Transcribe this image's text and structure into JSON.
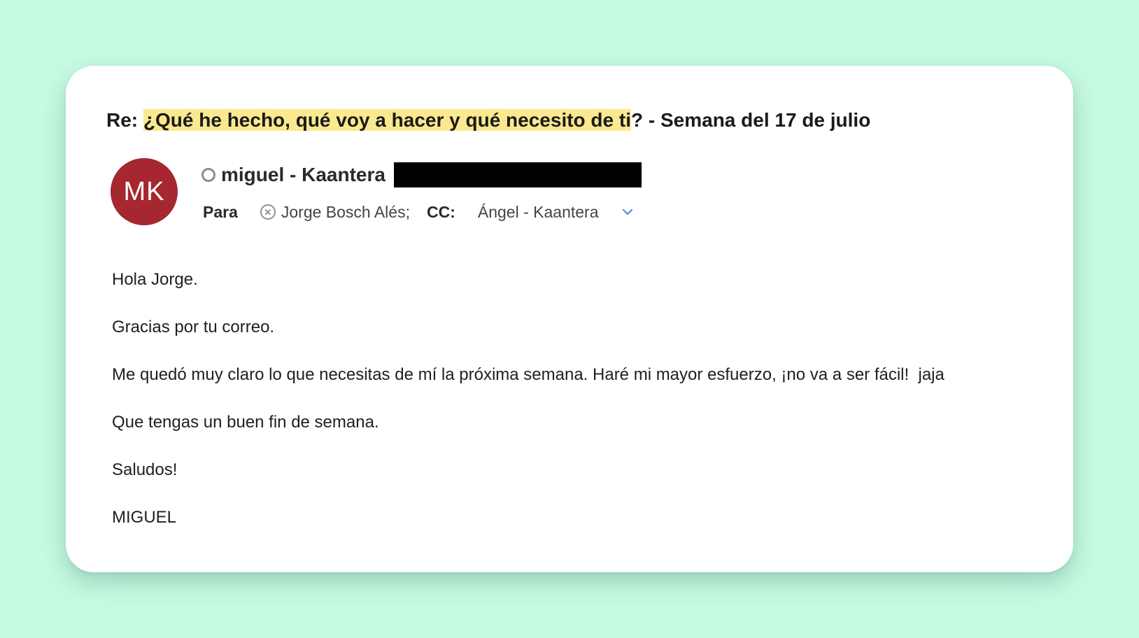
{
  "email": {
    "subject_prefix": "Re: ",
    "subject_highlight": "¿Qué he hecho, qué voy a hacer y qué necesito de ti",
    "subject_suffix": "? - Semana del 17 de julio",
    "sender": {
      "initials": "MK",
      "name": "miguel - Kaantera",
      "avatar_color": "#a6272f"
    },
    "recipients": {
      "to_label": "Para",
      "to": "Jorge Bosch Alés;",
      "cc_label": "CC:",
      "cc": "Ángel - Kaantera"
    },
    "body": [
      "Hola Jorge.",
      "Gracias por tu correo.",
      "Me quedó muy claro lo que necesitas de mí la próxima semana. Haré mi mayor esfuerzo, ¡no va a ser fácil!  jaja",
      "Que tengas un buen fin de semana.",
      "Saludos!",
      "MIGUEL"
    ]
  },
  "colors": {
    "background": "#c6fbe2",
    "highlight": "#fbe98f",
    "chevron": "#4a90e2"
  },
  "icons": {
    "presence": "presence-circle-icon",
    "remove": "remove-recipient-icon",
    "expand": "chevron-down-icon"
  }
}
